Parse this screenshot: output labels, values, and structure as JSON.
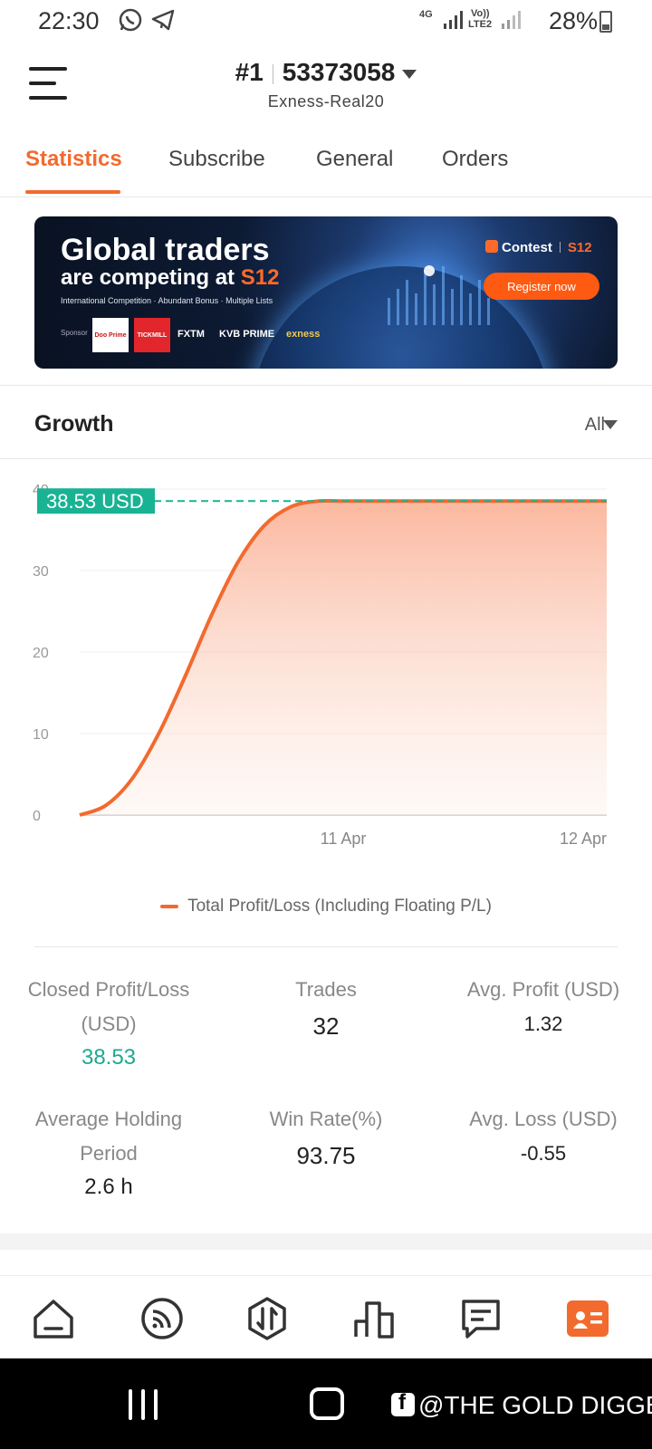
{
  "status_bar": {
    "time": "22:30",
    "network_top": "4G",
    "network_volte": "Vo))",
    "network_lte": "LTE2",
    "battery": "28%"
  },
  "header": {
    "rank": "#1",
    "account": "53373058",
    "server": "Exness-Real20"
  },
  "tabs": [
    "Statistics",
    "Subscribe",
    "General",
    "Orders"
  ],
  "active_tab": "Statistics",
  "banner": {
    "title_line1": "Global traders",
    "title_line2_prefix": "are competing at ",
    "title_line2_brand": "S12",
    "subtitle": "International Competition · Abundant Bonus · Multiple Lists",
    "sponsor_label": "Sponsor",
    "sponsors": [
      "Doo Prime",
      "TICKMILL",
      "FXTM",
      "KVB PRIME",
      "exness"
    ],
    "contest_label": "Contest",
    "contest_brand": "S12",
    "register_label": "Register now"
  },
  "growth": {
    "title": "Growth",
    "filter": "All"
  },
  "chart_data": {
    "type": "area",
    "series": [
      {
        "name": "Total Profit/Loss (Including Floating P/L)",
        "color": "#f26a2e",
        "x": [
          0,
          0.05,
          0.1,
          0.15,
          0.2,
          0.25,
          0.3,
          0.35,
          0.4,
          0.45,
          0.5,
          0.55,
          0.6,
          0.7,
          0.8,
          0.9,
          1.0
        ],
        "values": [
          0,
          1.2,
          4.5,
          10,
          17,
          24.5,
          31,
          35.5,
          37.8,
          38.5,
          38.53,
          38.53,
          38.53,
          38.53,
          38.53,
          38.53,
          38.53
        ]
      }
    ],
    "x_tick_labels": [
      "11 Apr",
      "12 Apr"
    ],
    "y_ticks": [
      0,
      10,
      20,
      30,
      40
    ],
    "ylim": [
      0,
      40
    ],
    "current_value_label": "38.53 USD",
    "current_value": 38.53,
    "fill_color": "#fbb49a",
    "marker_color": "#19b394"
  },
  "stats": {
    "closed_pl_label": "Closed Profit/Loss (USD)",
    "closed_pl_label_1": "Closed Profit/Loss",
    "closed_pl_label_2": "(USD)",
    "closed_pl_value": "38.53",
    "trades_label": "Trades",
    "trades_value": "32",
    "avg_profit_label": "Avg. Profit (USD)",
    "avg_profit_value": "1.32",
    "avg_holding_label_1": "Average Holding",
    "avg_holding_label_2": "Period",
    "avg_holding_value": "2.6 h",
    "win_rate_label": "Win Rate(%)",
    "win_rate_value": "93.75",
    "avg_loss_label": "Avg. Loss (USD)",
    "avg_loss_value": "-0.55"
  },
  "bottom_nav": [
    "home-icon",
    "feed-icon",
    "trade-icon",
    "chart-icon",
    "chat-icon",
    "profile-card-icon"
  ],
  "accent_color": "#f26a2e",
  "watermark": "@THE GOLD DIGGER"
}
